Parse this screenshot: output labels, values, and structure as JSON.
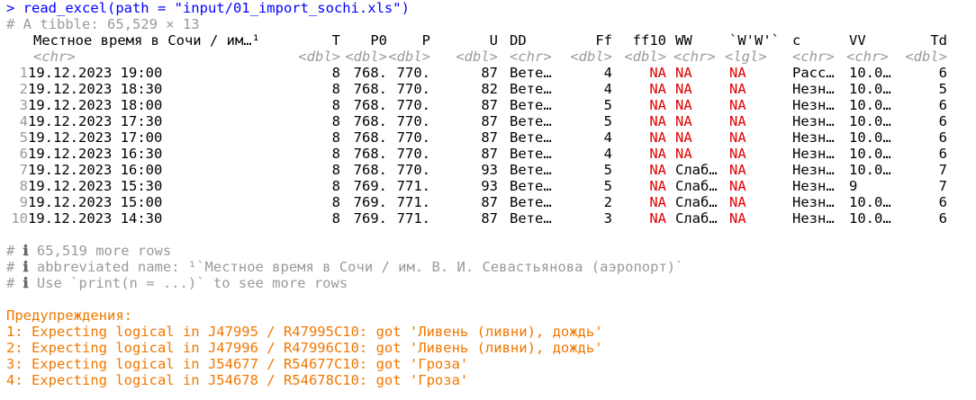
{
  "command": "> read_excel(path = \"input/01_import_sochi.xls\")",
  "tibble_info": "# A tibble: 65,529 × 13",
  "headers": [
    "Местное время в Сочи / им…¹",
    "T",
    "P0",
    "P",
    "U",
    "DD",
    "Ff",
    "ff10",
    "WW",
    "`W'W'`",
    "c",
    "VV",
    "Td"
  ],
  "types": [
    "<chr>",
    "<dbl>",
    "<dbl>",
    "<dbl>",
    "<dbl>",
    "<chr>",
    "<dbl>",
    "<dbl>",
    "<chr>",
    "<lgl>",
    "<chr>",
    "<chr>",
    "<dbl>"
  ],
  "rows": [
    [
      "1",
      "19.12.2023 19:00",
      "8",
      "768.",
      "770.",
      "87",
      "Вете…",
      "4",
      "NA",
      "NA",
      "NA",
      "Расс…",
      "10.0…",
      "6"
    ],
    [
      "2",
      "19.12.2023 18:30",
      "8",
      "768.",
      "770.",
      "82",
      "Вете…",
      "4",
      "NA",
      "NA",
      "NA",
      "Незн…",
      "10.0…",
      "5"
    ],
    [
      "3",
      "19.12.2023 18:00",
      "8",
      "768.",
      "770.",
      "87",
      "Вете…",
      "5",
      "NA",
      "NA",
      "NA",
      "Незн…",
      "10.0…",
      "6"
    ],
    [
      "4",
      "19.12.2023 17:30",
      "8",
      "768.",
      "770.",
      "87",
      "Вете…",
      "5",
      "NA",
      "NA",
      "NA",
      "Незн…",
      "10.0…",
      "6"
    ],
    [
      "5",
      "19.12.2023 17:00",
      "8",
      "768.",
      "770.",
      "87",
      "Вете…",
      "4",
      "NA",
      "NA",
      "NA",
      "Незн…",
      "10.0…",
      "6"
    ],
    [
      "6",
      "19.12.2023 16:30",
      "8",
      "768.",
      "770.",
      "87",
      "Вете…",
      "4",
      "NA",
      "NA",
      "NA",
      "Незн…",
      "10.0…",
      "6"
    ],
    [
      "7",
      "19.12.2023 16:00",
      "8",
      "768.",
      "770.",
      "93",
      "Вете…",
      "5",
      "NA",
      "Слаб…",
      "NA",
      "Незн…",
      "10.0…",
      "7"
    ],
    [
      "8",
      "19.12.2023 15:30",
      "8",
      "769.",
      "771.",
      "93",
      "Вете…",
      "5",
      "NA",
      "Слаб…",
      "NA",
      "Незн…",
      "9",
      "7"
    ],
    [
      "9",
      "19.12.2023 15:00",
      "8",
      "769.",
      "771.",
      "87",
      "Вете…",
      "2",
      "NA",
      "Слаб…",
      "NA",
      "Незн…",
      "10.0…",
      "6"
    ],
    [
      "10",
      "19.12.2023 14:30",
      "8",
      "769.",
      "771.",
      "87",
      "Вете…",
      "3",
      "NA",
      "Слаб…",
      "NA",
      "Незн…",
      "10.0…",
      "6"
    ]
  ],
  "info_lines": [
    {
      "prefix": "# ",
      "icon": "ℹ",
      "text": " 65,519 more rows"
    },
    {
      "prefix": "# ",
      "icon": "ℹ",
      "text": " abbreviated name: ¹`Местное время в Сочи / им. В. И. Севастьянова (аэропорт)`"
    },
    {
      "prefix": "# ",
      "icon": "ℹ",
      "text": " Use `print(n = ...)` to see more rows"
    }
  ],
  "warnings_title": "Предупреждения:",
  "warnings": [
    "1: Expecting logical in J47995 / R47995C10: got 'Ливень (ливни), дождь'",
    "2: Expecting logical in J47996 / R47996C10: got 'Ливень (ливни), дождь'",
    "3: Expecting logical in J54677 / R54677C10: got 'Гроза'",
    "4: Expecting logical in J54678 / R54678C10: got 'Гроза'"
  ]
}
